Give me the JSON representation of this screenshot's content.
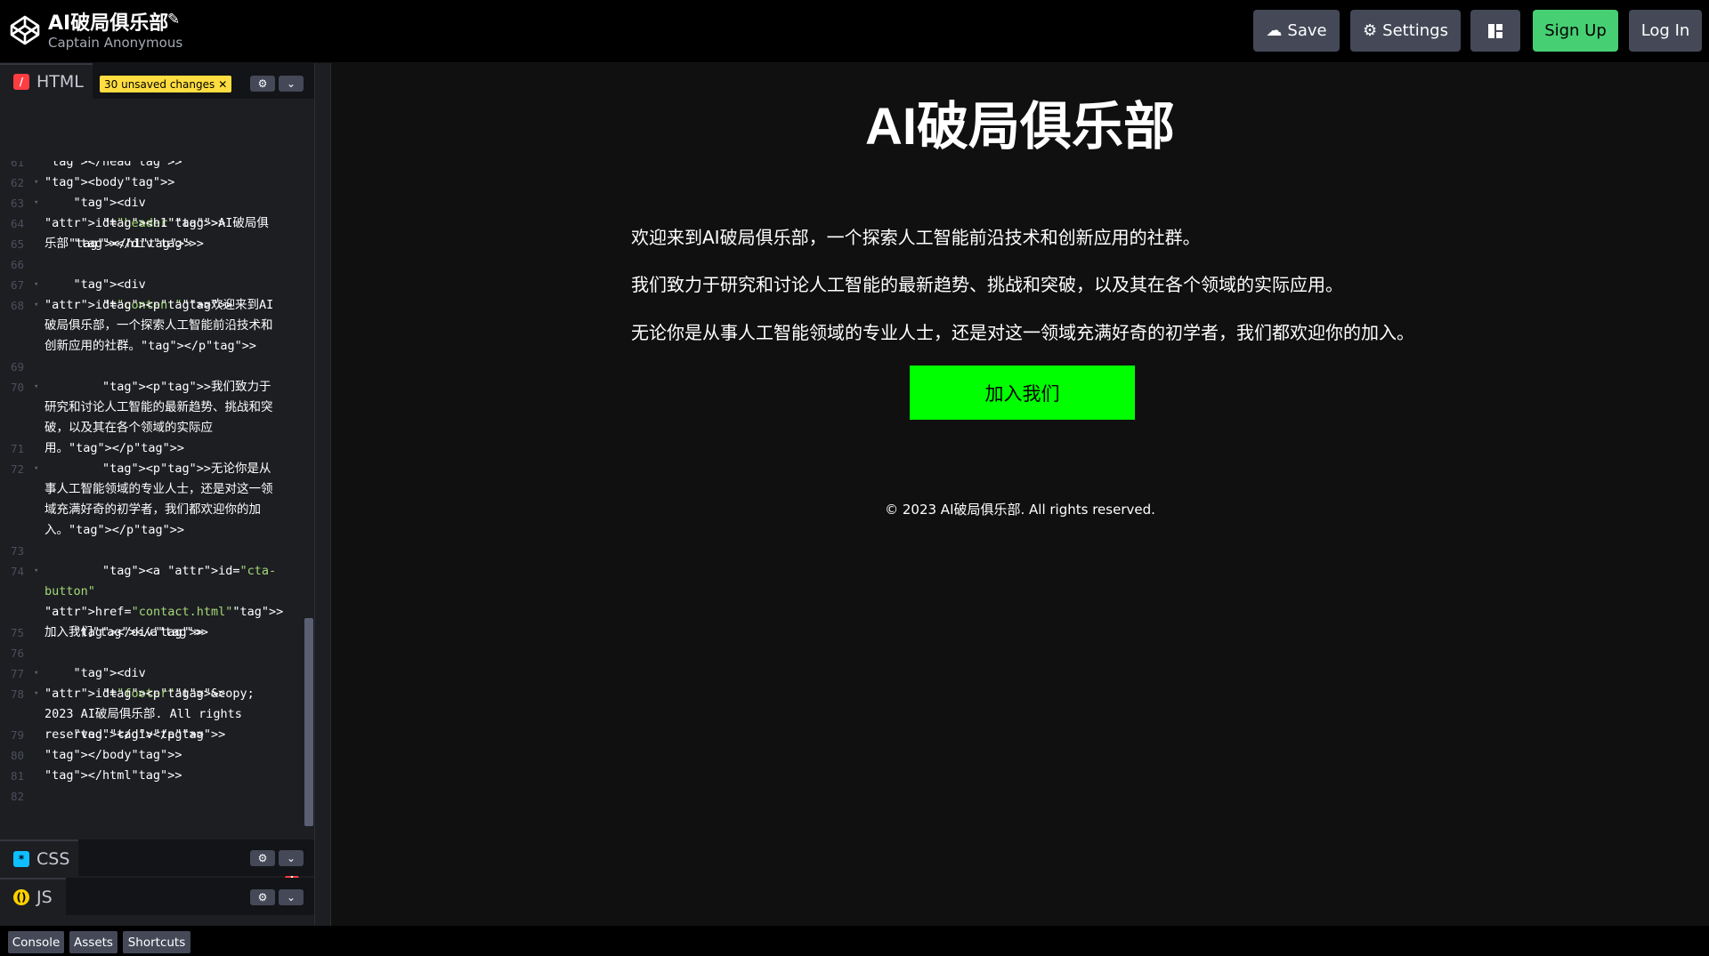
{
  "header": {
    "title": "AI破局俱乐部",
    "author": "Captain Anonymous",
    "save_label": "Save",
    "settings_label": "Settings",
    "signup_label": "Sign Up",
    "login_label": "Log In"
  },
  "editor": {
    "html_tab": "HTML",
    "unsaved_badge": "30 unsaved changes",
    "css_tab": "CSS",
    "js_tab": "JS"
  },
  "code_lines": [
    {
      "n": "61",
      "text": "</head>"
    },
    {
      "n": "62",
      "text": "<body>"
    },
    {
      "n": "63",
      "text": "    <div id=\"header\">"
    },
    {
      "n": "64",
      "text": "        <h1>AI破局俱乐部</h1>"
    },
    {
      "n": "65",
      "text": "    </div>"
    },
    {
      "n": "66",
      "text": ""
    },
    {
      "n": "67",
      "text": "    <div id=\"content\">"
    },
    {
      "n": "68",
      "text": "        <p>欢迎来到AI破局俱乐部，一个探索人工智能前沿技术和创新应用的社群。</p>"
    },
    {
      "n": "69",
      "text": ""
    },
    {
      "n": "70",
      "text": "        <p>我们致力于研究和讨论人工智能的最新趋势、挑战和突破，以及其在各个领域的实际应用。</p>"
    },
    {
      "n": "71",
      "text": ""
    },
    {
      "n": "72",
      "text": "        <p>无论你是从事人工智能领域的专业人士，还是对这一领域充满好奇的初学者，我们都欢迎你的加入。</p>"
    },
    {
      "n": "73",
      "text": ""
    },
    {
      "n": "74",
      "text": "        <a id=\"cta-button\" href=\"contact.html\">加入我们</a>"
    },
    {
      "n": "75",
      "text": "    </div>"
    },
    {
      "n": "76",
      "text": ""
    },
    {
      "n": "77",
      "text": "    <div id=\"footer\">"
    },
    {
      "n": "78",
      "text": "        <p>&copy; 2023 AI破局俱乐部. All rights reserved.</p>"
    },
    {
      "n": "79",
      "text": "    </div>"
    },
    {
      "n": "80",
      "text": "</body>"
    },
    {
      "n": "81",
      "text": "</html>"
    },
    {
      "n": "82",
      "text": ""
    }
  ],
  "preview": {
    "title": "AI破局俱乐部",
    "p1": "欢迎来到AI破局俱乐部，一个探索人工智能前沿技术和创新应用的社群。",
    "p2": "我们致力于研究和讨论人工智能的最新趋势、挑战和突破，以及其在各个领域的实际应用。",
    "p3": "无论你是从事人工智能领域的专业人士，还是对这一领域充满好奇的初学者，我们都欢迎你的加入。",
    "cta": "加入我们",
    "footer": "© 2023 AI破局俱乐部. All rights reserved."
  },
  "bottom": {
    "console": "Console",
    "assets": "Assets",
    "shortcuts": "Shortcuts"
  },
  "colors": {
    "signup": "#47cf73",
    "cta": "#00ff00",
    "badge": "#ffdd40"
  }
}
